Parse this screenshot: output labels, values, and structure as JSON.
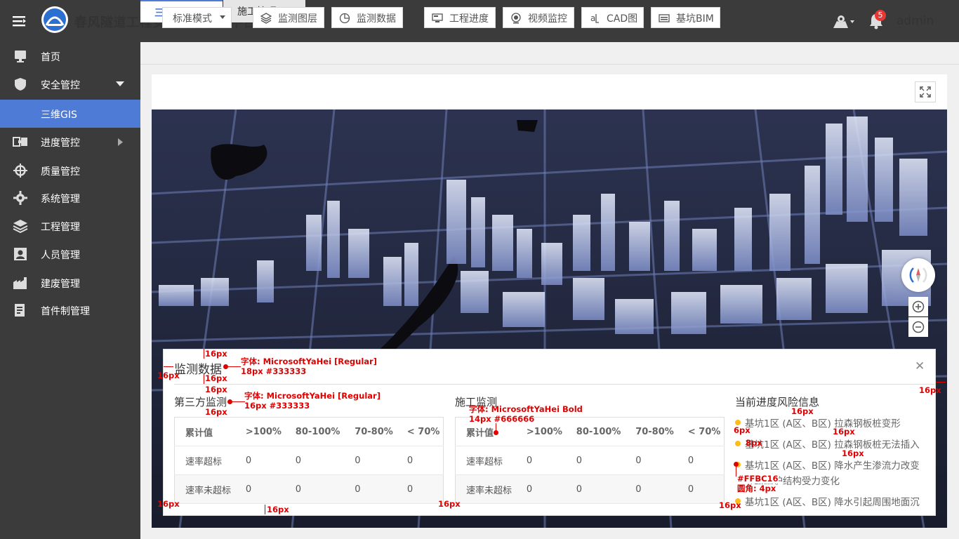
{
  "header": {
    "title": "春风隧道工程安全风险管控平台",
    "user": "admin",
    "notification_count": "5"
  },
  "sidebar": {
    "items": [
      {
        "label": "首页",
        "icon": "monitor-icon"
      },
      {
        "label": "安全管控",
        "icon": "shield-icon",
        "expanded": true
      },
      {
        "label": "三维GIS",
        "sub": true,
        "active": true
      },
      {
        "label": "进度管控",
        "icon": "progress-icon",
        "arrow": "right"
      },
      {
        "label": "质量管控",
        "icon": "crosshair-icon"
      },
      {
        "label": "系统管理",
        "icon": "gear-icon"
      },
      {
        "label": "工程管理",
        "icon": "layers-icon"
      },
      {
        "label": "人员管理",
        "icon": "person-card-icon"
      },
      {
        "label": "建废管理",
        "icon": "factory-icon"
      },
      {
        "label": "首件制管理",
        "icon": "document-icon"
      }
    ]
  },
  "tabs": [
    {
      "label": "三维GIS",
      "active": true
    },
    {
      "label": "施工管理"
    }
  ],
  "toolbar": {
    "mode": "标准模式",
    "layers": "监测图层",
    "monitor_data": "监测数据",
    "progress": "工程进度",
    "video": "视频监控",
    "cad": "CAD图",
    "bim": "基坑BIM"
  },
  "panel": {
    "title": "监测数据",
    "third_party": {
      "title": "第三方监测",
      "headers": [
        "累计值",
        ">100%",
        "80-100%",
        "70-80%",
        "< 70%"
      ],
      "rows": [
        {
          "label": "速率超标",
          "values": [
            "0",
            "0",
            "0",
            "0"
          ]
        },
        {
          "label": "速率未超标",
          "values": [
            "0",
            "0",
            "0",
            "0"
          ]
        }
      ]
    },
    "construction": {
      "title": "施工监测",
      "headers": [
        "累计值",
        ">100%",
        "80-100%",
        "70-80%",
        "< 70%"
      ],
      "rows": [
        {
          "label": "速率超标",
          "values": [
            "0",
            "0",
            "0",
            "0"
          ]
        },
        {
          "label": "速率未超标",
          "values": [
            "0",
            "0",
            "0",
            "0"
          ]
        }
      ]
    },
    "risk": {
      "title": "当前进度风险信息",
      "items": [
        "基坑1区 (A区、B区) 拉森钢板桩变形",
        "基坑1区 (A区、B区) 拉森钢板桩无法插入",
        "基坑1区 (A区、B区) 降水产生渗流力改变",
        "导致围护结构受力变化",
        "基坑1区 (A区、B区) 降水引起周围地面沉"
      ],
      "dot_color": "#FFBC16"
    }
  },
  "annotations": {
    "a16": "16px",
    "a6": "6px",
    "a8": "8px",
    "font_title": "字体: MicrosoftYaHei [Regular]",
    "size_title": "18px #333333",
    "font_sub": "字体: MicrosoftYaHei [Regular]",
    "size_sub": "16px #333333",
    "font_bold": "字体: MicrosoftYaHei Bold",
    "size_bold": "14px #666666",
    "dot_color": "#FFBC16",
    "radius": "圆角: 4px"
  },
  "colors": {
    "accent": "#4d7bd6",
    "header_bg": "#3b3b3b",
    "annotation": "#e00000"
  }
}
